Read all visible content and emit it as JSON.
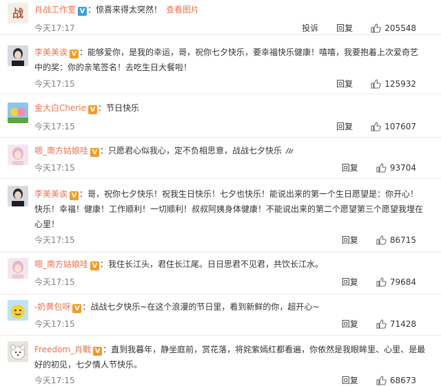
{
  "comments": [
    {
      "user": "肖战工作室",
      "badge": "V",
      "badge_color": "#3b9ee6",
      "text": "惊喜来得太突然！",
      "link": "查看图片",
      "time": "今天17:17",
      "report": "投诉",
      "reply": "回复",
      "likes": "205548",
      "avatar_icon": "studio-logo-avatar"
    },
    {
      "user": "李美美诶",
      "badge": "V",
      "badge_color": "#f49a27",
      "text": "能够爱你，是我的幸运，哥，祝你七夕快乐，要幸福快乐健康！嘻嘻，我要抱着上次爱奇艺中的奖：你的亲笔签名！去吃生日大餐啦！",
      "time": "今天17:15",
      "reply": "回复",
      "likes": "125932"
    },
    {
      "user": "金大白Cherie",
      "badge": "V",
      "badge_color": "#f49a27",
      "text": "节日快乐",
      "time": "今天17:15",
      "reply": "回复",
      "likes": "107607"
    },
    {
      "user": "嗯_南方姑娘哇",
      "badge": "V",
      "badge_color": "#f49a27",
      "text": "只愿君心似我心，定不负相思意，战战七夕快乐",
      "time": "今天17:15",
      "reply": "回复",
      "likes": "93704"
    },
    {
      "user": "李美美诶",
      "badge": "V",
      "badge_color": "#f49a27",
      "text": "哥，祝你七夕快乐！祝我生日快乐！七夕也快乐！能说出来的第一个生日愿望是：你开心！快乐！幸福！健康！工作顺利！一切顺利！叔叔阿姨身体健康！不能说出来的第二个愿望第三个愿望我埋在心里！",
      "time": "今天17:15",
      "reply": "回复",
      "likes": "86715"
    },
    {
      "user": "嗯_南方姑娘哇",
      "badge": "V",
      "badge_color": "#f49a27",
      "text": "我住长江头，君住长江尾。日日思君不见君，共饮长江水。",
      "time": "今天17:15",
      "reply": "回复",
      "likes": "79684"
    },
    {
      "user": "-奶黄包呀",
      "badge": "V",
      "badge_color": "#f49a27",
      "text": "战战七夕快乐~在这个浪漫的节日里，看到新鲜的你，超开心~",
      "time": "今天17:15",
      "reply": "回复",
      "likes": "71428"
    },
    {
      "user": "Freedom_肖戰",
      "badge": "V",
      "badge_color": "#f49a27",
      "text": "直到我暮年，静坐庭前，赏花落，将姹紫嫣红都看遍，你依然是我眼眸里、心里、是最好的初见，七夕情人节快乐。",
      "time": "今天17:15",
      "reply": "回复",
      "likes": "68673"
    }
  ],
  "colors": {
    "username": "#eb7350",
    "time": "#808080",
    "text": "#333333"
  }
}
